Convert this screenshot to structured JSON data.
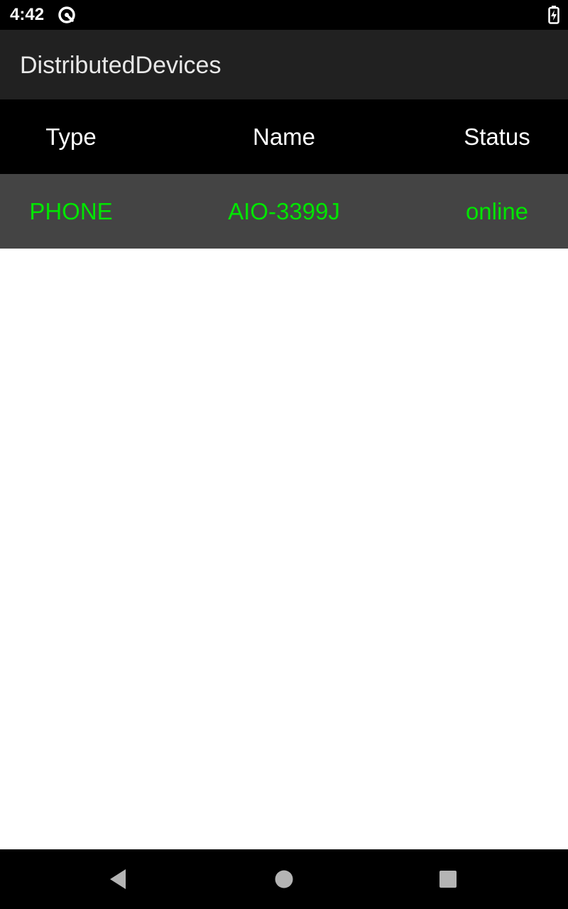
{
  "status_bar": {
    "time": "4:42",
    "notification_icon": "data-saver-icon",
    "battery_icon": "battery-charging-icon"
  },
  "app_bar": {
    "title": "DistributedDevices"
  },
  "table": {
    "headers": [
      "Type",
      "Name",
      "Status"
    ],
    "rows": [
      [
        "PHONE",
        "AIO-3399J",
        "online"
      ]
    ],
    "row_background": "#444444",
    "row_text_color": "#00e600"
  },
  "nav_bar": {
    "back_icon": "back-triangle-icon",
    "home_icon": "home-circle-icon",
    "recents_icon": "recents-square-icon"
  }
}
